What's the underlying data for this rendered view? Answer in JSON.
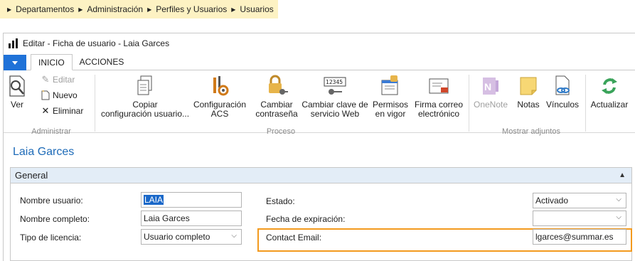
{
  "breadcrumb": [
    "Departamentos",
    "Administración",
    "Perfiles y Usuarios",
    "Usuarios"
  ],
  "window": {
    "title": "Editar - Ficha de usuario - Laia Garces"
  },
  "tabs": [
    {
      "label": "INICIO"
    },
    {
      "label": "ACCIONES"
    }
  ],
  "ribbon": {
    "ver": "Ver",
    "editar": "Editar",
    "nuevo": "Nuevo",
    "eliminar": "Eliminar",
    "copiar_l1": "Copiar",
    "copiar_l2": "configuración usuario...",
    "conf_acs_l1": "Configuración",
    "conf_acs_l2": "ACS",
    "cambiar_pwd_l1": "Cambiar",
    "cambiar_pwd_l2": "contraseña",
    "cambiar_clave_l1": "Cambiar clave de",
    "cambiar_clave_l2": "servicio Web",
    "permisos_l1": "Permisos",
    "permisos_l2": "en vigor",
    "firma_l1": "Firma correo",
    "firma_l2": "electrónico",
    "onenote": "OneNote",
    "notas": "Notas",
    "vinculos": "Vínculos",
    "actualizar": "Actualizar",
    "group_administrar": "Administrar",
    "group_proceso": "Proceso",
    "group_adjuntos": "Mostrar adjuntos"
  },
  "record_title": "Laia Garces",
  "fasttab": {
    "title": "General"
  },
  "fields": {
    "nombre_usuario_label": "Nombre usuario:",
    "nombre_usuario_value": "LAIA",
    "nombre_completo_label": "Nombre completo:",
    "nombre_completo_value": "Laia Garces",
    "tipo_licencia_label": "Tipo de licencia:",
    "tipo_licencia_value": "Usuario completo",
    "estado_label": "Estado:",
    "estado_value": "Activado",
    "fecha_exp_label": "Fecha de expiración:",
    "fecha_exp_value": "",
    "contact_email_label": "Contact Email:",
    "contact_email_value": "lgarces@summar.es"
  },
  "colors": {
    "accent": "#1f72d8",
    "breadcrumb_bg": "#fdf2c3",
    "highlight": "#f39a1e",
    "title": "#1e6bb8"
  }
}
